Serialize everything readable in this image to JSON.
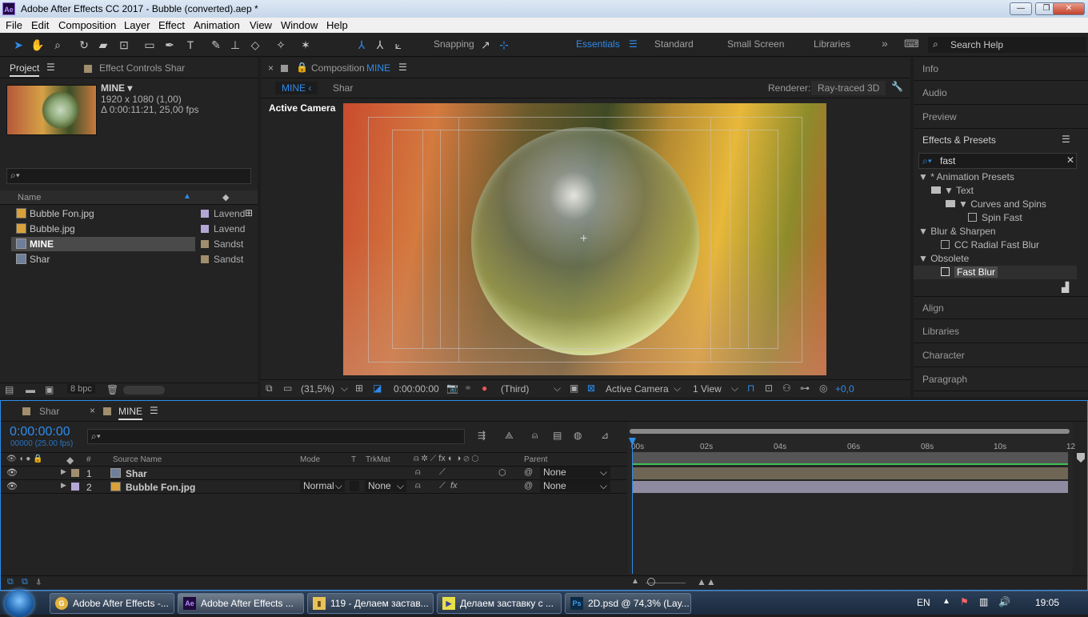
{
  "window": {
    "title": "Adobe After Effects CC 2017 - Bubble (converted).aep *",
    "logo": "Ae"
  },
  "menu": [
    "File",
    "Edit",
    "Composition",
    "Layer",
    "Effect",
    "Animation",
    "View",
    "Window",
    "Help"
  ],
  "toolbar": {
    "snapping": "Snapping"
  },
  "workspaces": {
    "items": [
      "Essentials",
      "Standard",
      "Small Screen",
      "Libraries"
    ],
    "active": "Essentials",
    "search_placeholder": "Search Help"
  },
  "project": {
    "tab_project": "Project",
    "tab_effect_controls": "Effect Controls Shar",
    "comp_name": "MINE ▾",
    "comp_size": "1920 x 1080 (1,00)",
    "comp_duration": "Δ 0:00:11:21, 25,00 fps",
    "col_name": "Name",
    "items": [
      {
        "name": "Bubble Fon.jpg",
        "label": "Lavend",
        "color": "#b4a7d6"
      },
      {
        "name": "Bubble.jpg",
        "label": "Lavend",
        "color": "#b4a7d6"
      },
      {
        "name": "MINE",
        "label": "Sandst",
        "color": "#a08e6d"
      },
      {
        "name": "Shar",
        "label": "Sandst",
        "color": "#a08e6d"
      }
    ],
    "bpc": "8 bpc"
  },
  "composition": {
    "tab_prefix": "Composition",
    "tab_name": "MINE",
    "breadcrumb_active": "MINE",
    "breadcrumb_next": "Shar",
    "renderer_label": "Renderer:",
    "renderer_value": "Ray-traced 3D",
    "viewer_label": "Active Camera",
    "zoom": "(31,5%)",
    "timecode": "0:00:00:00",
    "resolution": "(Third)",
    "camera": "Active Camera",
    "views": "1 View",
    "exposure": "+0,0"
  },
  "right_panel": {
    "top_tabs": [
      "Info",
      "Audio",
      "Preview"
    ],
    "effects_title": "Effects & Presets",
    "search_value": "fast",
    "tree": [
      {
        "text": "▼ * Animation Presets",
        "indent": 0
      },
      {
        "text": "▼ Text",
        "indent": 1,
        "folder": true
      },
      {
        "text": "▼ Curves and Spins",
        "indent": 2,
        "folder": true
      },
      {
        "text": "Spin Fast",
        "indent": 3,
        "fx": true
      },
      {
        "text": "▼ Blur & Sharpen",
        "indent": 0
      },
      {
        "text": "CC Radial Fast Blur",
        "indent": 2,
        "fx": true
      },
      {
        "text": "▼ Obsolete",
        "indent": 0
      },
      {
        "text": "Fast Blur",
        "indent": 2,
        "fx": true,
        "selected": true
      }
    ],
    "bottom_tabs": [
      "Align",
      "Libraries",
      "Character",
      "Paragraph"
    ]
  },
  "timeline": {
    "tab_shar": "Shar",
    "tab_mine": "MINE",
    "timecode": "0:00:00:00",
    "fps": "00000 (25.00 fps)",
    "col_num": "#",
    "col_source": "Source Name",
    "col_mode": "Mode",
    "col_t": "T",
    "col_trkmat": "TrkMat",
    "col_parent": "Parent",
    "ruler": [
      "00s",
      "02s",
      "04s",
      "06s",
      "08s",
      "10s",
      "12"
    ],
    "layers": [
      {
        "num": "1",
        "name": "Shar",
        "color": "#a08e6d",
        "mode": "",
        "trkmat": "",
        "parent": "None"
      },
      {
        "num": "2",
        "name": "Bubble Fon.jpg",
        "color": "#b4a7d6",
        "mode": "Normal",
        "trkmat": "None",
        "parent": "None"
      }
    ]
  },
  "taskbar": {
    "items": [
      {
        "label": "Adobe After Effects -...",
        "icon": "G",
        "color": "#e3b341"
      },
      {
        "label": "Adobe After Effects ...",
        "icon": "Ae",
        "color": "#9a6ad8",
        "active": true
      },
      {
        "label": "119 - Делаем застав...",
        "icon": "▮",
        "color": "#e8c35a"
      },
      {
        "label": "Делаем заставку с ...",
        "icon": "▶",
        "color": "#7a80d0"
      },
      {
        "label": "2D.psd @ 74,3% (Lay...",
        "icon": "Ps",
        "color": "#3d9be8"
      }
    ],
    "lang": "EN",
    "clock": "19:05"
  }
}
